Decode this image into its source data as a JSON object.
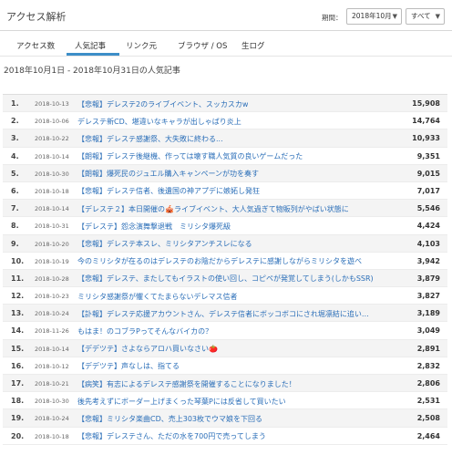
{
  "header": {
    "title": "アクセス解析",
    "period_label": "期間：",
    "month_select": "2018年10月",
    "view_select": "すべて"
  },
  "tabs": [
    {
      "label": "アクセス数",
      "active": false
    },
    {
      "label": "人気記事",
      "active": true
    },
    {
      "label": "リンク元",
      "active": false
    },
    {
      "label": "ブラウザ / OS",
      "active": false
    },
    {
      "label": "生ログ",
      "active": false
    }
  ],
  "range_title": "2018年10月1日 - 2018年10月31日の人気記事",
  "rows": [
    {
      "rank": "1.",
      "date": "2018-10-13",
      "title": "【悲報】デレステ2のライブイベント、スッカスカw",
      "count": "15,908"
    },
    {
      "rank": "2.",
      "date": "2018-10-06",
      "title": "デレステ新CD、堪違いなキャラが出しゃばり炎上",
      "count": "14,764"
    },
    {
      "rank": "3.",
      "date": "2018-10-22",
      "title": "【悲報】デレステ感謝祭、大失敗に終わる...",
      "count": "10,933"
    },
    {
      "rank": "4.",
      "date": "2018-10-14",
      "title": "【朗報】デレステ後継機、作っては壊す職人気質の良いゲームだった",
      "count": "9,351"
    },
    {
      "rank": "5.",
      "date": "2018-10-30",
      "title": "【朗報】爆死民のジュエル購入キャンペーンが功を奏す",
      "count": "9,015"
    },
    {
      "rank": "6.",
      "date": "2018-10-18",
      "title": "【悲報】デレステ信者、後遺国の神アプデに嫉妬し発狂",
      "count": "7,017"
    },
    {
      "rank": "7.",
      "date": "2018-10-14",
      "title": "【デレステ２】本日開催の🎪ライブイベント、大人気過ぎて物販列がやばい状態に",
      "count": "5,546"
    },
    {
      "rank": "8.",
      "date": "2018-10-31",
      "title": "【デレステ】怨念演舞撃退戦　ミリシタ爆死級",
      "count": "4,424"
    },
    {
      "rank": "9.",
      "date": "2018-10-20",
      "title": "【悲報】デレステ本スレ、ミリシタアンチスレになる",
      "count": "4,103"
    },
    {
      "rank": "10.",
      "date": "2018-10-19",
      "title": "今のミリシタが在るのはデレステのお陰だからデレステに感謝しながらミリシタを遊べ",
      "count": "3,942"
    },
    {
      "rank": "11.",
      "date": "2018-10-28",
      "title": "【悲報】デレステ、またしてもイラストの使い回し、コピペが発覚してしまう(しかもSSR)",
      "count": "3,879"
    },
    {
      "rank": "12.",
      "date": "2018-10-23",
      "title": "ミリシタ感謝祭が懼くてたまらないデレマス信者",
      "count": "3,827"
    },
    {
      "rank": "13.",
      "date": "2018-10-24",
      "title": "【訃報】デレステ応援アカウントさん、デレステ信者にボッコボコにされ堀凛結に追い込ま...",
      "count": "3,189"
    },
    {
      "rank": "14.",
      "date": "2018-11-26",
      "title": "もはま！のコブラPってそんなバイカの？",
      "count": "3,049"
    },
    {
      "rank": "15.",
      "date": "2018-10-14",
      "title": "【デデツテ】さよならアロハ買いなさい🍅",
      "count": "2,891"
    },
    {
      "rank": "16.",
      "date": "2018-10-12",
      "title": "【デデツテ】声なしは、指てる",
      "count": "2,832"
    },
    {
      "rank": "17.",
      "date": "2018-10-21",
      "title": "【病笑】有志によるデレステ感謝祭を開催することになりました！",
      "count": "2,806"
    },
    {
      "rank": "18.",
      "date": "2018-10-30",
      "title": "後先考えずにボーダー上げまくった琴葉Pには反省して買いたい",
      "count": "2,531"
    },
    {
      "rank": "19.",
      "date": "2018-10-24",
      "title": "【悲報】ミリシタ楽曲CD、売上303枚でウマ娘を下回る",
      "count": "2,508"
    },
    {
      "rank": "20.",
      "date": "2018-10-18",
      "title": "【悲報】デレステさん、ただの水を700円で売ってしまう",
      "count": "2,464"
    }
  ]
}
